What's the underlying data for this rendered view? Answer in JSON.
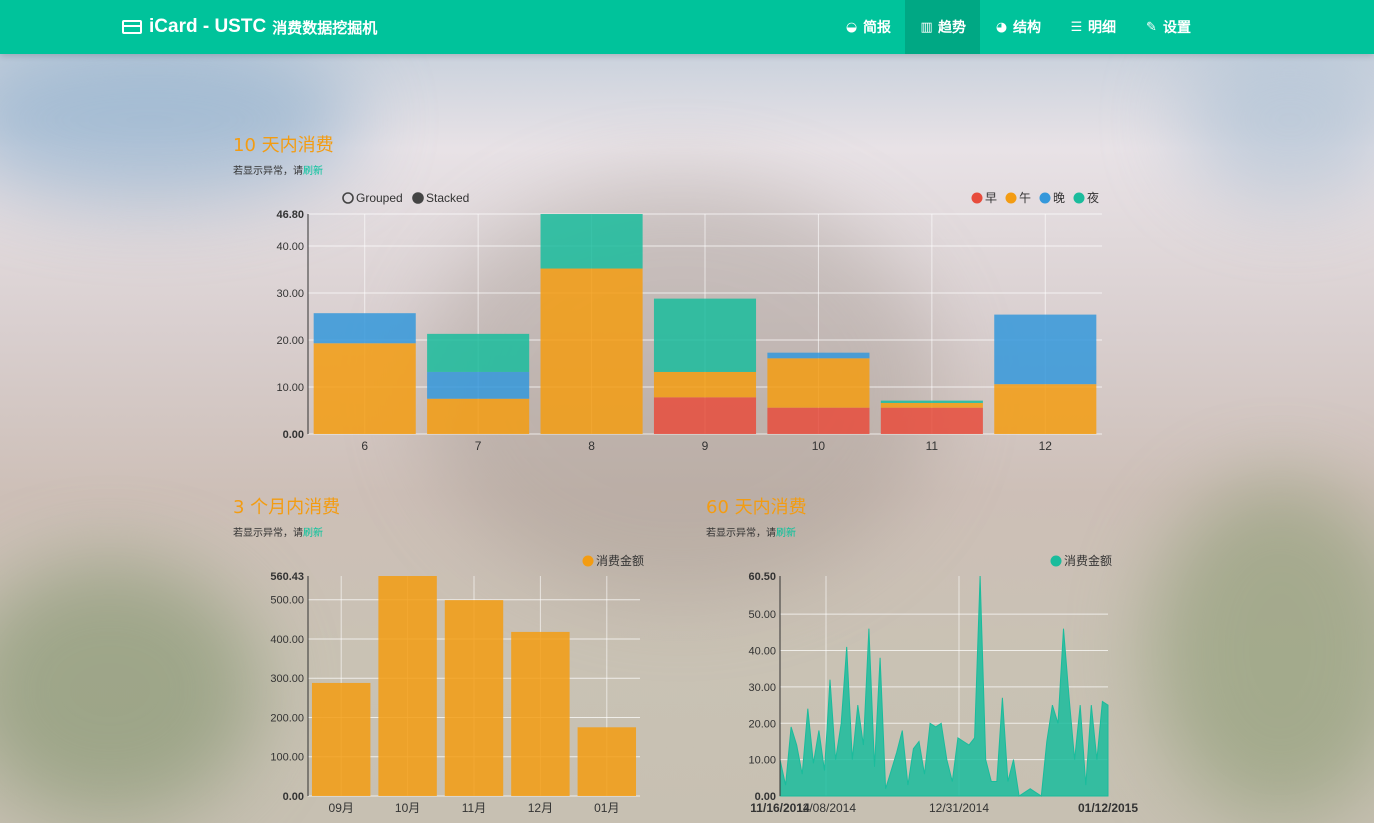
{
  "navbar": {
    "brand_title": "iCard - USTC",
    "brand_subtitle": "消费数据挖掘机",
    "items": [
      {
        "label": "简报",
        "icon": "dashboard-icon",
        "active": false
      },
      {
        "label": "趋势",
        "icon": "bar-chart-icon",
        "active": true
      },
      {
        "label": "结构",
        "icon": "pie-chart-icon",
        "active": false
      },
      {
        "label": "明细",
        "icon": "list-icon",
        "active": false
      },
      {
        "label": "设置",
        "icon": "wrench-icon",
        "active": false
      }
    ]
  },
  "sections": {
    "ten_day": {
      "title": "10 天内消费",
      "hint_prefix": "若显示异常，请",
      "hint_link": "刷新"
    },
    "three_month": {
      "title": "3 个月内消费",
      "hint_prefix": "若显示异常，请",
      "hint_link": "刷新"
    },
    "sixty_day": {
      "title": "60 天内消费",
      "hint_prefix": "若显示异常，请",
      "hint_link": "刷新"
    }
  },
  "colors": {
    "accent": "#00c39b",
    "title": "#f39c12",
    "early": "#e74c3c",
    "noon": "#f39c12",
    "evening": "#3498db",
    "night": "#1abc9c"
  },
  "chart_data": [
    {
      "type": "bar",
      "stacked": true,
      "controls": [
        "Grouped",
        "Stacked"
      ],
      "selected_control": "Stacked",
      "categories": [
        "6",
        "7",
        "8",
        "9",
        "10",
        "11",
        "12"
      ],
      "series": [
        {
          "name": "早",
          "values": [
            0,
            0,
            0,
            7.8,
            5.6,
            5.6,
            0
          ]
        },
        {
          "name": "午",
          "values": [
            19.3,
            7.5,
            35.2,
            5.4,
            10.5,
            1.0,
            10.6
          ]
        },
        {
          "name": "晚",
          "values": [
            6.4,
            5.7,
            0,
            0,
            1.2,
            0,
            14.8
          ]
        },
        {
          "name": "夜",
          "values": [
            0,
            8.1,
            11.6,
            15.6,
            0,
            0.5,
            0
          ]
        }
      ],
      "ylim": [
        0,
        46.8
      ],
      "yticks": [
        "0.00",
        "10.00",
        "20.00",
        "30.00",
        "40.00"
      ],
      "ymax_label": "46.80",
      "legend": "top-right",
      "grid": true
    },
    {
      "type": "bar",
      "categories": [
        "09月",
        "10月",
        "11月",
        "12月",
        "01月"
      ],
      "series": [
        {
          "name": "消费金额",
          "values": [
            288,
            560.43,
            499,
            418,
            175
          ]
        }
      ],
      "ylim": [
        0,
        560.43
      ],
      "yticks": [
        "0.00",
        "100.00",
        "200.00",
        "300.00",
        "400.00",
        "500.00"
      ],
      "ymax_label": "560.43",
      "legend": "top-right",
      "grid": true
    },
    {
      "type": "area",
      "x_start": "11/16/2014",
      "x_end": "01/15/2015",
      "xtick_labels": [
        "12/08/2014",
        "12/31/2014"
      ],
      "xmin_label": "11/16/2014",
      "xmax_label": "01/12/2015",
      "series": [
        {
          "name": "消费金额",
          "values": [
            10,
            3,
            19,
            14,
            6,
            24,
            9,
            18,
            7,
            32,
            10,
            20,
            41,
            10,
            25,
            14,
            46,
            8,
            38,
            2,
            7,
            12,
            18,
            3,
            13,
            15,
            6,
            20,
            19,
            20,
            10,
            4,
            16,
            15,
            14,
            16,
            60.5,
            10,
            4,
            4,
            27,
            4,
            10,
            0,
            1,
            2,
            1,
            0,
            15,
            25,
            20,
            46,
            27,
            10,
            25,
            3,
            25,
            10,
            26,
            25
          ]
        }
      ],
      "ylim": [
        0,
        60.5
      ],
      "yticks": [
        "0.00",
        "10.00",
        "20.00",
        "30.00",
        "40.00",
        "50.00"
      ],
      "ymax_label": "60.50",
      "legend": "top-right",
      "grid": true
    }
  ]
}
